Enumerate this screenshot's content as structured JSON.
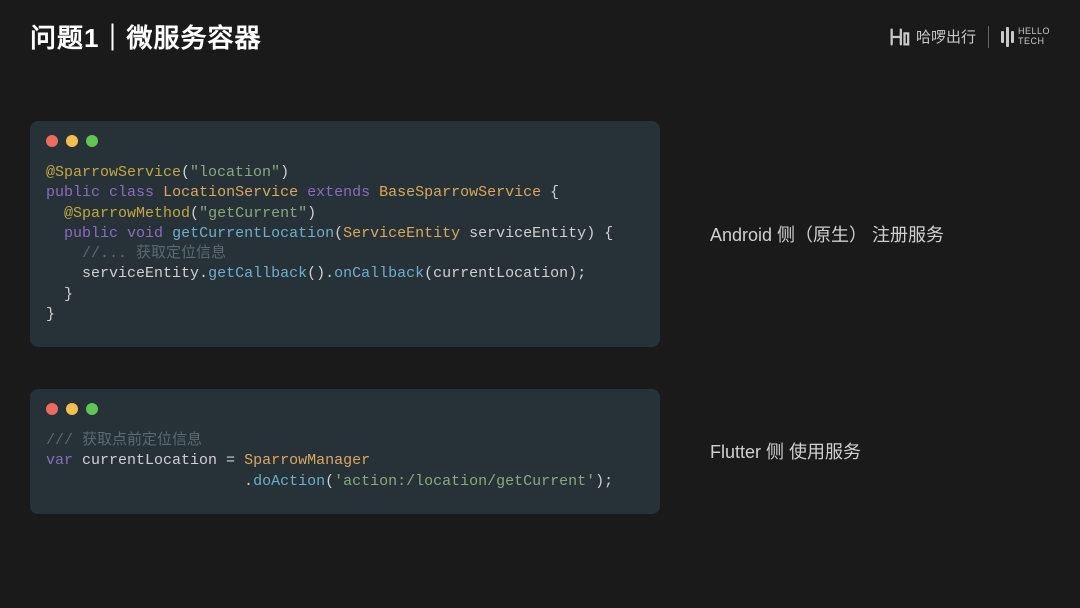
{
  "header": {
    "title": "问题1｜微服务容器",
    "logo_text": "哈啰出行",
    "tech_hello": "HELLO",
    "tech_tech": "TECH"
  },
  "block1": {
    "caption": "Android 侧（原生） 注册服务",
    "l1_anno": "@SparrowService",
    "l1_paren_open": "(",
    "l1_str": "\"location\"",
    "l1_paren_close": ")",
    "l2_public": "public",
    "l2_class": "class",
    "l2_name": "LocationService",
    "l2_extends": "extends",
    "l2_base": "BaseSparrowService",
    "l2_brace": " {",
    "l3_indent": "  ",
    "l3_anno": "@SparrowMethod",
    "l3_paren_open": "(",
    "l3_str": "\"getCurrent\"",
    "l3_paren_close": ")",
    "l4_indent": "  ",
    "l4_public": "public",
    "l4_void": "void",
    "l4_name": "getCurrentLocation",
    "l4_paren_open": "(",
    "l4_ptype": "ServiceEntity",
    "l4_pname": " serviceEntity",
    "l4_paren_close": ")",
    "l4_brace": " {",
    "l5_indent": "    ",
    "l5_comment": "//... 获取定位信息",
    "l6_indent": "    ",
    "l6_var": "serviceEntity",
    "l6_dot1": ".",
    "l6_get": "getCallback",
    "l6_parens1": "()",
    "l6_dot2": ".",
    "l6_cb": "onCallback",
    "l6_paren_open": "(",
    "l6_arg": "currentLocation",
    "l6_paren_close": ");",
    "l7": "  }",
    "l8": "}"
  },
  "block2": {
    "caption": "Flutter 侧 使用服务",
    "l1_comment": "/// 获取点前定位信息",
    "l2_var": "var",
    "l2_name": " currentLocation ",
    "l2_eq": "=",
    "l2_mgr": " SparrowManager",
    "l3_indent": "                      ",
    "l3_dot": ".",
    "l3_method": "doAction",
    "l3_paren_open": "(",
    "l3_str": "'action:/location/getCurrent'",
    "l3_paren_close": ");"
  }
}
